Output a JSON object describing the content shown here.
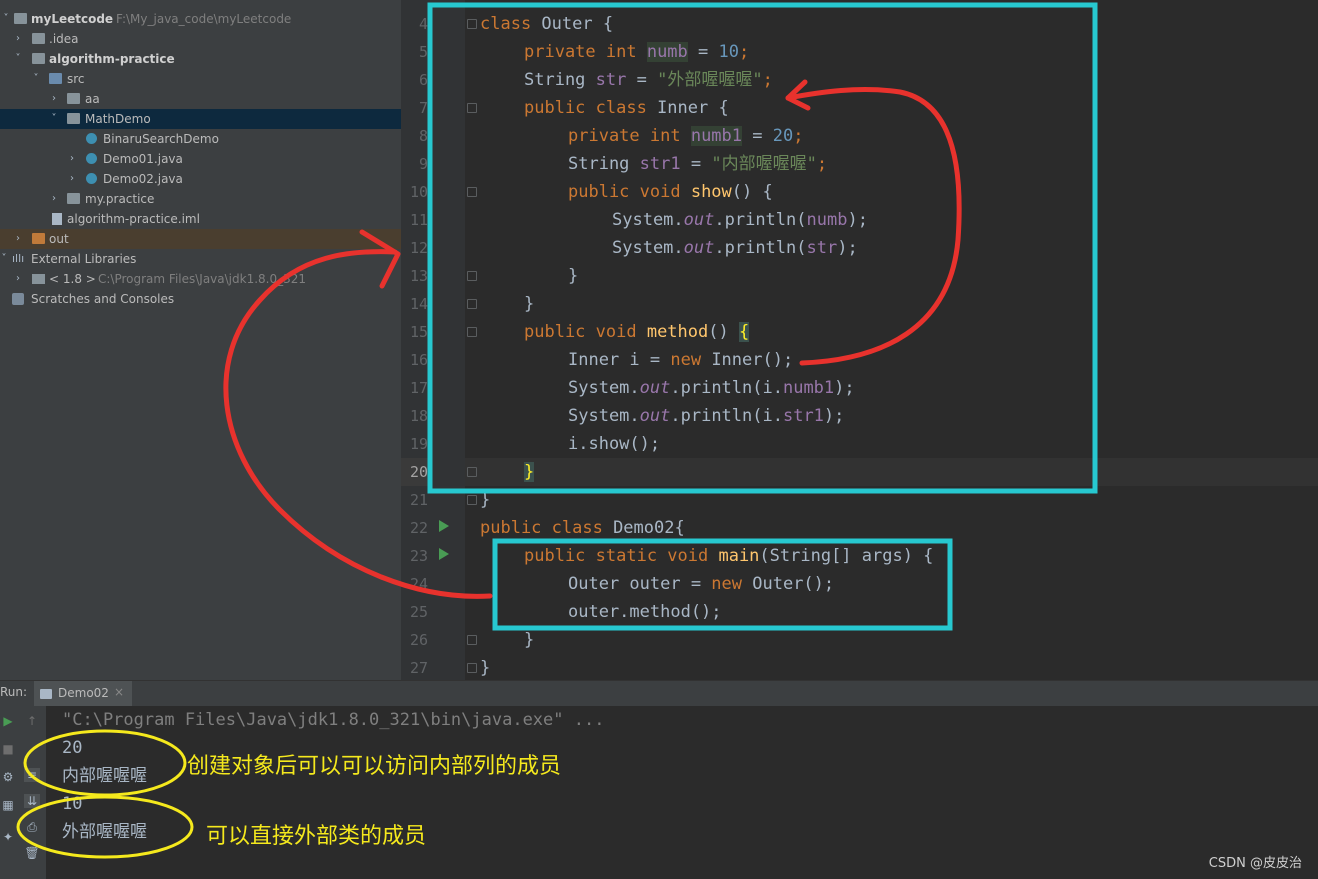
{
  "project": {
    "name": "myLeetcode",
    "path": "F:\\My_java_code\\myLeetcode",
    "tree": [
      {
        "label": ".idea"
      },
      {
        "label": "algorithm-practice"
      },
      {
        "label": "src"
      },
      {
        "label": "aa"
      },
      {
        "label": "MathDemo"
      },
      {
        "label": "BinaruSearchDemo"
      },
      {
        "label": "Demo01.java"
      },
      {
        "label": "Demo02.java"
      },
      {
        "label": "my.practice"
      },
      {
        "label": "algorithm-practice.iml"
      },
      {
        "label": "out"
      },
      {
        "label": "External Libraries"
      },
      {
        "label": "< 1.8 >",
        "path": "C:\\Program Files\\Java\\jdk1.8.0_321"
      },
      {
        "label": "Scratches and Consoles"
      }
    ]
  },
  "editor": {
    "line_numbers": [
      "4",
      "5",
      "6",
      "7",
      "8",
      "9",
      "10",
      "11",
      "12",
      "13",
      "14",
      "15",
      "16",
      "17",
      "18",
      "19",
      "20",
      "21",
      "22",
      "23",
      "24",
      "25",
      "26",
      "27"
    ],
    "current_line": "20",
    "code": {
      "l4": [
        "class",
        " Outer {"
      ],
      "l5": [
        "private int ",
        "numb",
        " = ",
        "10",
        ";"
      ],
      "l6": [
        "String ",
        "str",
        " = ",
        "\"外部喔喔喔\"",
        ";"
      ],
      "l7": [
        "public class ",
        "Inner {"
      ],
      "l8": [
        "private int ",
        "numb1",
        " = ",
        "20",
        ";"
      ],
      "l9": [
        "String ",
        "str1",
        " = ",
        "\"内部喔喔喔\"",
        ";"
      ],
      "l10": [
        "public void ",
        "show",
        "() {"
      ],
      "l11": [
        "System.",
        "out",
        ".println(",
        "numb",
        ");"
      ],
      "l12": [
        "System.",
        "out",
        ".println(",
        "str",
        ");"
      ],
      "l13": "}",
      "l14": "}",
      "l15": [
        "public void ",
        "method",
        "() ",
        "{"
      ],
      "l16": [
        "Inner i = ",
        "new ",
        "Inner();"
      ],
      "l17": [
        "System.",
        "out",
        ".println(i.",
        "numb1",
        ");"
      ],
      "l18": [
        "System.",
        "out",
        ".println(i.",
        "str1",
        ");"
      ],
      "l19": "i.show();",
      "l20": "}",
      "l21": "}",
      "l22": [
        "public class ",
        "Demo02{"
      ],
      "l23": [
        "public static void ",
        "main",
        "(String[] args) {"
      ],
      "l24": [
        "Outer outer = ",
        "new ",
        "Outer();"
      ],
      "l25": "outer.method();",
      "l26": "}",
      "l27": "}"
    }
  },
  "run": {
    "label": "Run:",
    "tab": "Demo02",
    "close": "×",
    "command": "\"C:\\Program Files\\Java\\jdk1.8.0_321\\bin\\java.exe\" ...",
    "output": [
      "20",
      "内部喔喔喔",
      "10",
      "外部喔喔喔"
    ]
  },
  "annotations": {
    "note1": "创建对象后可以可以访问内部列的成员",
    "note2": "可以直接外部类的成员",
    "color": "#f5e91d",
    "arrow_color": "#e8322d",
    "box_color": "#27c8d0"
  },
  "watermark": "CSDN @皮皮治"
}
